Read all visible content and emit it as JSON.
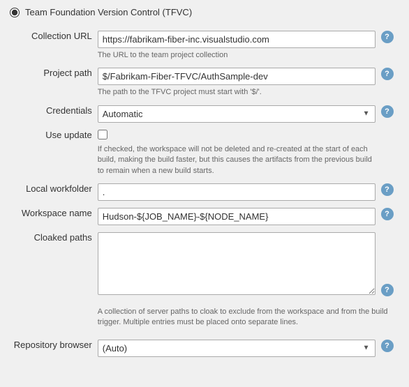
{
  "header": {
    "radio_selected": true,
    "label": "Team Foundation Version Control (TFVC)"
  },
  "fields": {
    "collection_url": {
      "label": "Collection URL",
      "value": "https://fabrikam-fiber-inc.visualstudio.com",
      "hint": "The URL to the team project collection"
    },
    "project_path": {
      "label": "Project path",
      "value": "$/Fabrikam-Fiber-TFVC/AuthSample-dev",
      "hint": "The path to the TFVC project must start with '$/'."
    },
    "credentials": {
      "label": "Credentials",
      "value": "Automatic",
      "options": [
        "Automatic"
      ],
      "hint": ""
    },
    "use_update": {
      "label": "Use update",
      "checked": false,
      "hint": "If checked, the workspace will not be deleted and re-created at the start of each build, making the build faster, but this causes the artifacts from the previous build to remain when a new build starts."
    },
    "local_workfolder": {
      "label": "Local workfolder",
      "value": ".",
      "hint": ""
    },
    "workspace_name": {
      "label": "Workspace name",
      "value": "Hudson-${JOB_NAME}-${NODE_NAME}",
      "hint": ""
    },
    "cloaked_paths": {
      "label": "Cloaked paths",
      "value": "",
      "hint": "A collection of server paths to cloak to exclude from the workspace and from the build trigger. Multiple entries must be placed onto separate lines."
    },
    "repository_browser": {
      "label": "Repository browser",
      "value": "(Auto)",
      "options": [
        "(Auto)"
      ],
      "hint": ""
    }
  },
  "icons": {
    "help": "?",
    "dropdown_arrow": "▼"
  }
}
